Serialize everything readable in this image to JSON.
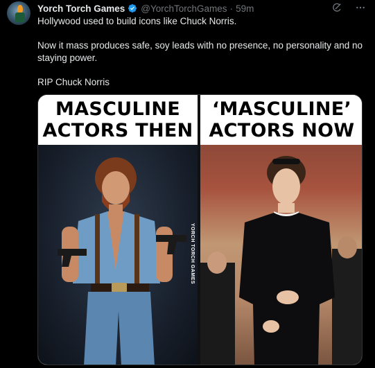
{
  "author": {
    "display_name": "Yorch Torch Games",
    "handle": "@YorchTorchGames",
    "timestamp": "59m",
    "avatar_icon": "torch-avatar-icon",
    "verified_icon": "verified-badge-icon",
    "verified_color": "#1d9bf0"
  },
  "actions": {
    "grok_icon": "grok-icon",
    "more_icon": "more-options-icon"
  },
  "tweet": {
    "lines": [
      "Hollywood used to build icons like Chuck Norris.",
      "Now it mass produces safe, soy leads with no presence, no personality and no staying power.",
      "RIP Chuck Norris"
    ]
  },
  "media": {
    "left_caption_line1": "MASCULINE",
    "left_caption_line2": "ACTORS THEN",
    "right_caption_line1": "‘MASCULINE’",
    "right_caption_line2": "ACTORS NOW",
    "watermark": "YORCH TORCH GAMES"
  },
  "colors": {
    "background": "#000000",
    "text": "#e7e9ea",
    "muted": "#71767b"
  }
}
